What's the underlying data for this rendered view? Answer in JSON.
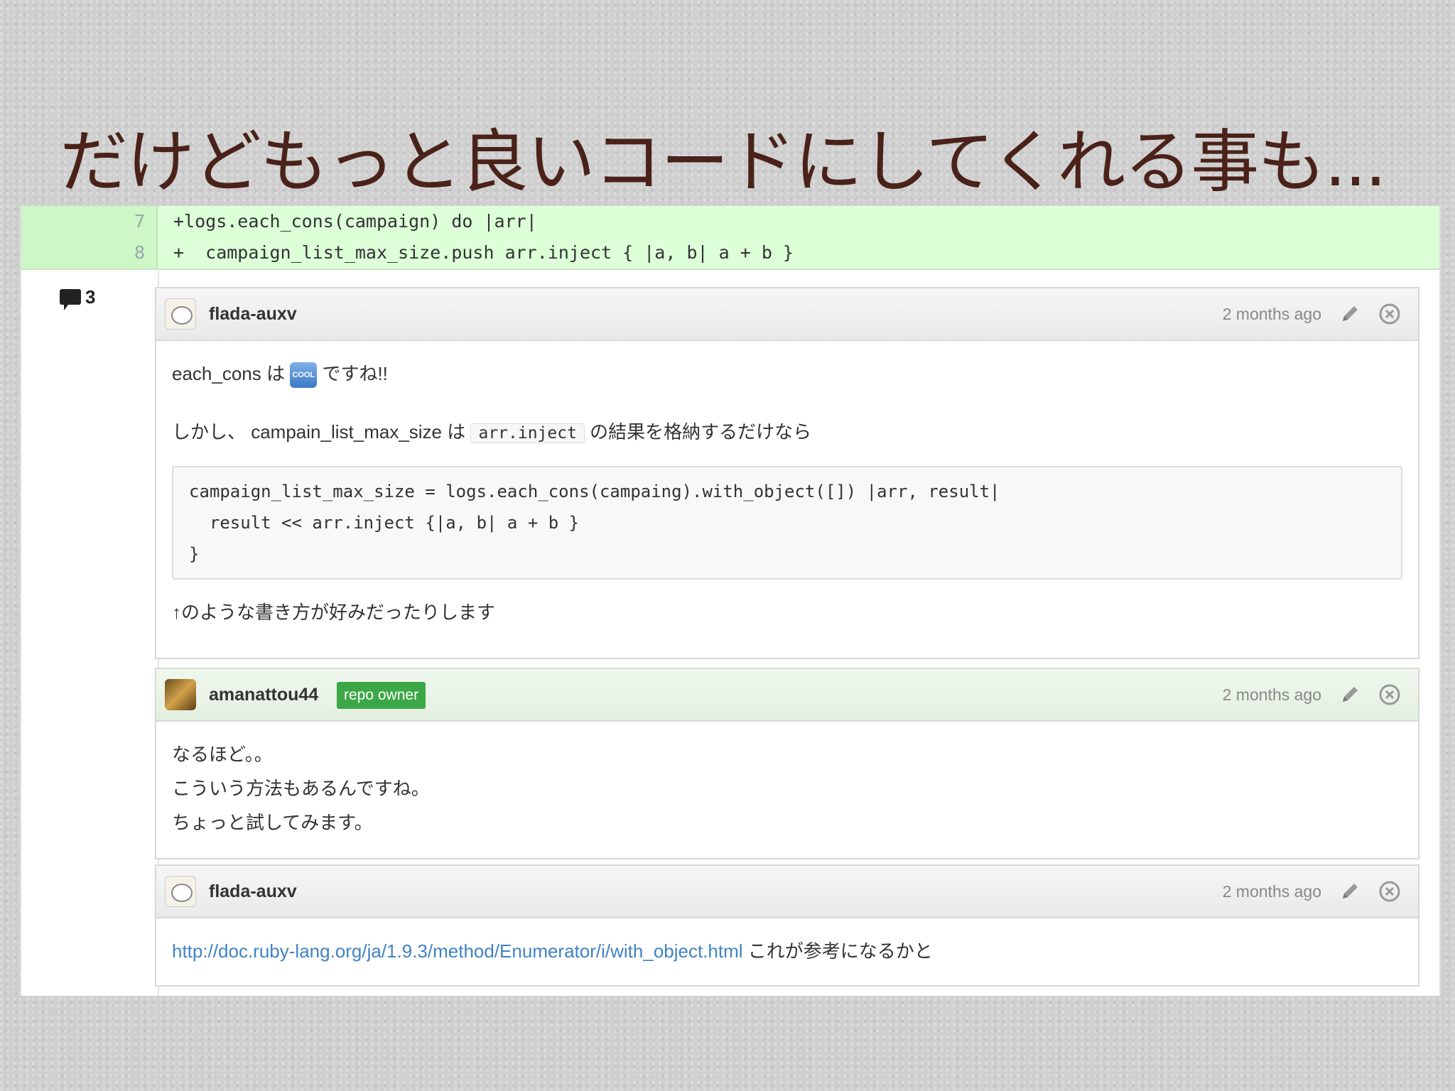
{
  "slide": {
    "title": "だけどもっと良いコードにしてくれる事も..."
  },
  "diff": {
    "lines": [
      {
        "number": "7",
        "code": "+logs.each_cons(campaign) do |arr|"
      },
      {
        "number": "8",
        "code": "+  campaign_list_max_size.push arr.inject { |a, b| a + b }"
      }
    ]
  },
  "comments_count": "3",
  "comments": [
    {
      "author": "flada-auxv",
      "time": "2 months ago",
      "line1_a": "each_cons は ",
      "emoji": "COOL",
      "line1_b": " ですね!!",
      "line2_a": "しかし、 campain_list_max_size は ",
      "line2_code": "arr.inject",
      "line2_b": " の結果を格納するだけなら",
      "code": "campaign_list_max_size = logs.each_cons(campaing).with_object([]) |arr, result|\n  result << arr.inject {|a, b| a + b }\n}",
      "line3": "↑のような書き方が好みだったりします"
    },
    {
      "author": "amanattou44",
      "badge": "repo owner",
      "time": "2 months ago",
      "line1": "なるほど。。",
      "line2": "こういう方法もあるんですね。",
      "line3": "ちょっと試してみます。"
    },
    {
      "author": "flada-auxv",
      "time": "2 months ago",
      "link": "http://doc.ruby-lang.org/ja/1.9.3/method/Enumerator/i/with_object.html",
      "text": " これが参考になるかと"
    }
  ]
}
